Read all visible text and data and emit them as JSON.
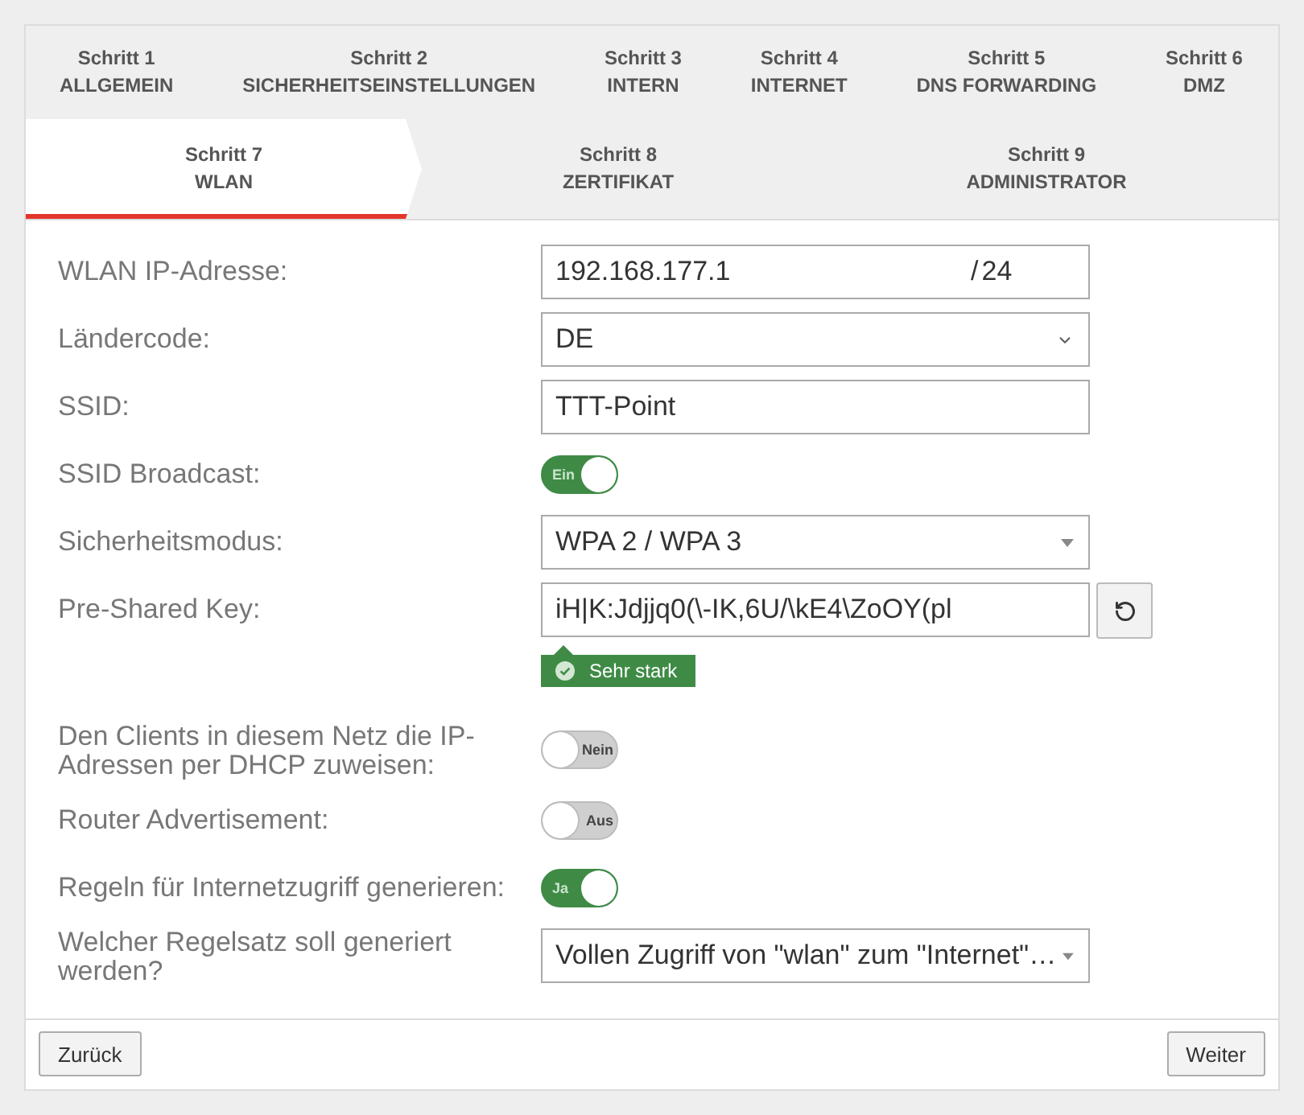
{
  "step_rows": [
    {
      "steps": [
        {
          "number": "Schritt 1",
          "title": "ALLGEMEIN",
          "selected": false
        },
        {
          "number": "Schritt 2",
          "title": "SICHERHEITSEINSTELLUNGEN",
          "selected": false
        },
        {
          "number": "Schritt 3",
          "title": "INTERN",
          "selected": false
        },
        {
          "number": "Schritt 4",
          "title": "INTERNET",
          "selected": false
        },
        {
          "number": "Schritt 5",
          "title": "DNS FORWARDING",
          "selected": false
        },
        {
          "number": "Schritt 6",
          "title": "DMZ",
          "selected": false
        }
      ]
    },
    {
      "steps": [
        {
          "number": "Schritt 7",
          "title": "WLAN",
          "selected": true
        },
        {
          "number": "Schritt 8",
          "title": "ZERTIFIKAT",
          "selected": false
        },
        {
          "number": "Schritt 9",
          "title": "ADMINISTRATOR",
          "selected": false
        }
      ]
    }
  ],
  "form": [
    {
      "kind": "ip",
      "label": "WLAN IP-Adresse:",
      "value": "192.168.177.1",
      "separator": "/",
      "netmask": "24"
    },
    {
      "kind": "native-select",
      "label": "Ländercode:",
      "value": "DE"
    },
    {
      "kind": "text",
      "label": "SSID:",
      "value": "TTT-Point"
    },
    {
      "kind": "toggle",
      "label": "SSID Broadcast:",
      "on": true,
      "state_label": "Ein"
    },
    {
      "kind": "select",
      "label": "Sicherheitsmodus:",
      "value": "WPA 2 / WPA 3"
    },
    {
      "kind": "key",
      "label": "Pre-Shared Key:",
      "value": "iH|K:Jdjjq0(\\-IK,6U/\\kE4\\ZoOY(pl",
      "strength": "Sehr stark"
    },
    {
      "kind": "toggle",
      "label": "Den Clients in diesem Netz die IP-Adressen per DHCP zuweisen:",
      "on": false,
      "state_label": "Nein"
    },
    {
      "kind": "toggle",
      "label": "Router Advertisement:",
      "on": false,
      "state_label": "Aus"
    },
    {
      "kind": "toggle",
      "label": "Regeln für Internetzugriff generieren:",
      "on": true,
      "state_label": "Ja"
    },
    {
      "kind": "select",
      "label": "Welcher Regelsatz soll generiert werden?",
      "value": "Vollen Zugriff von \"wlan\" zum \"Internet\"…"
    }
  ],
  "footer": {
    "buttons": [
      "Zurück",
      "Weiter"
    ]
  }
}
